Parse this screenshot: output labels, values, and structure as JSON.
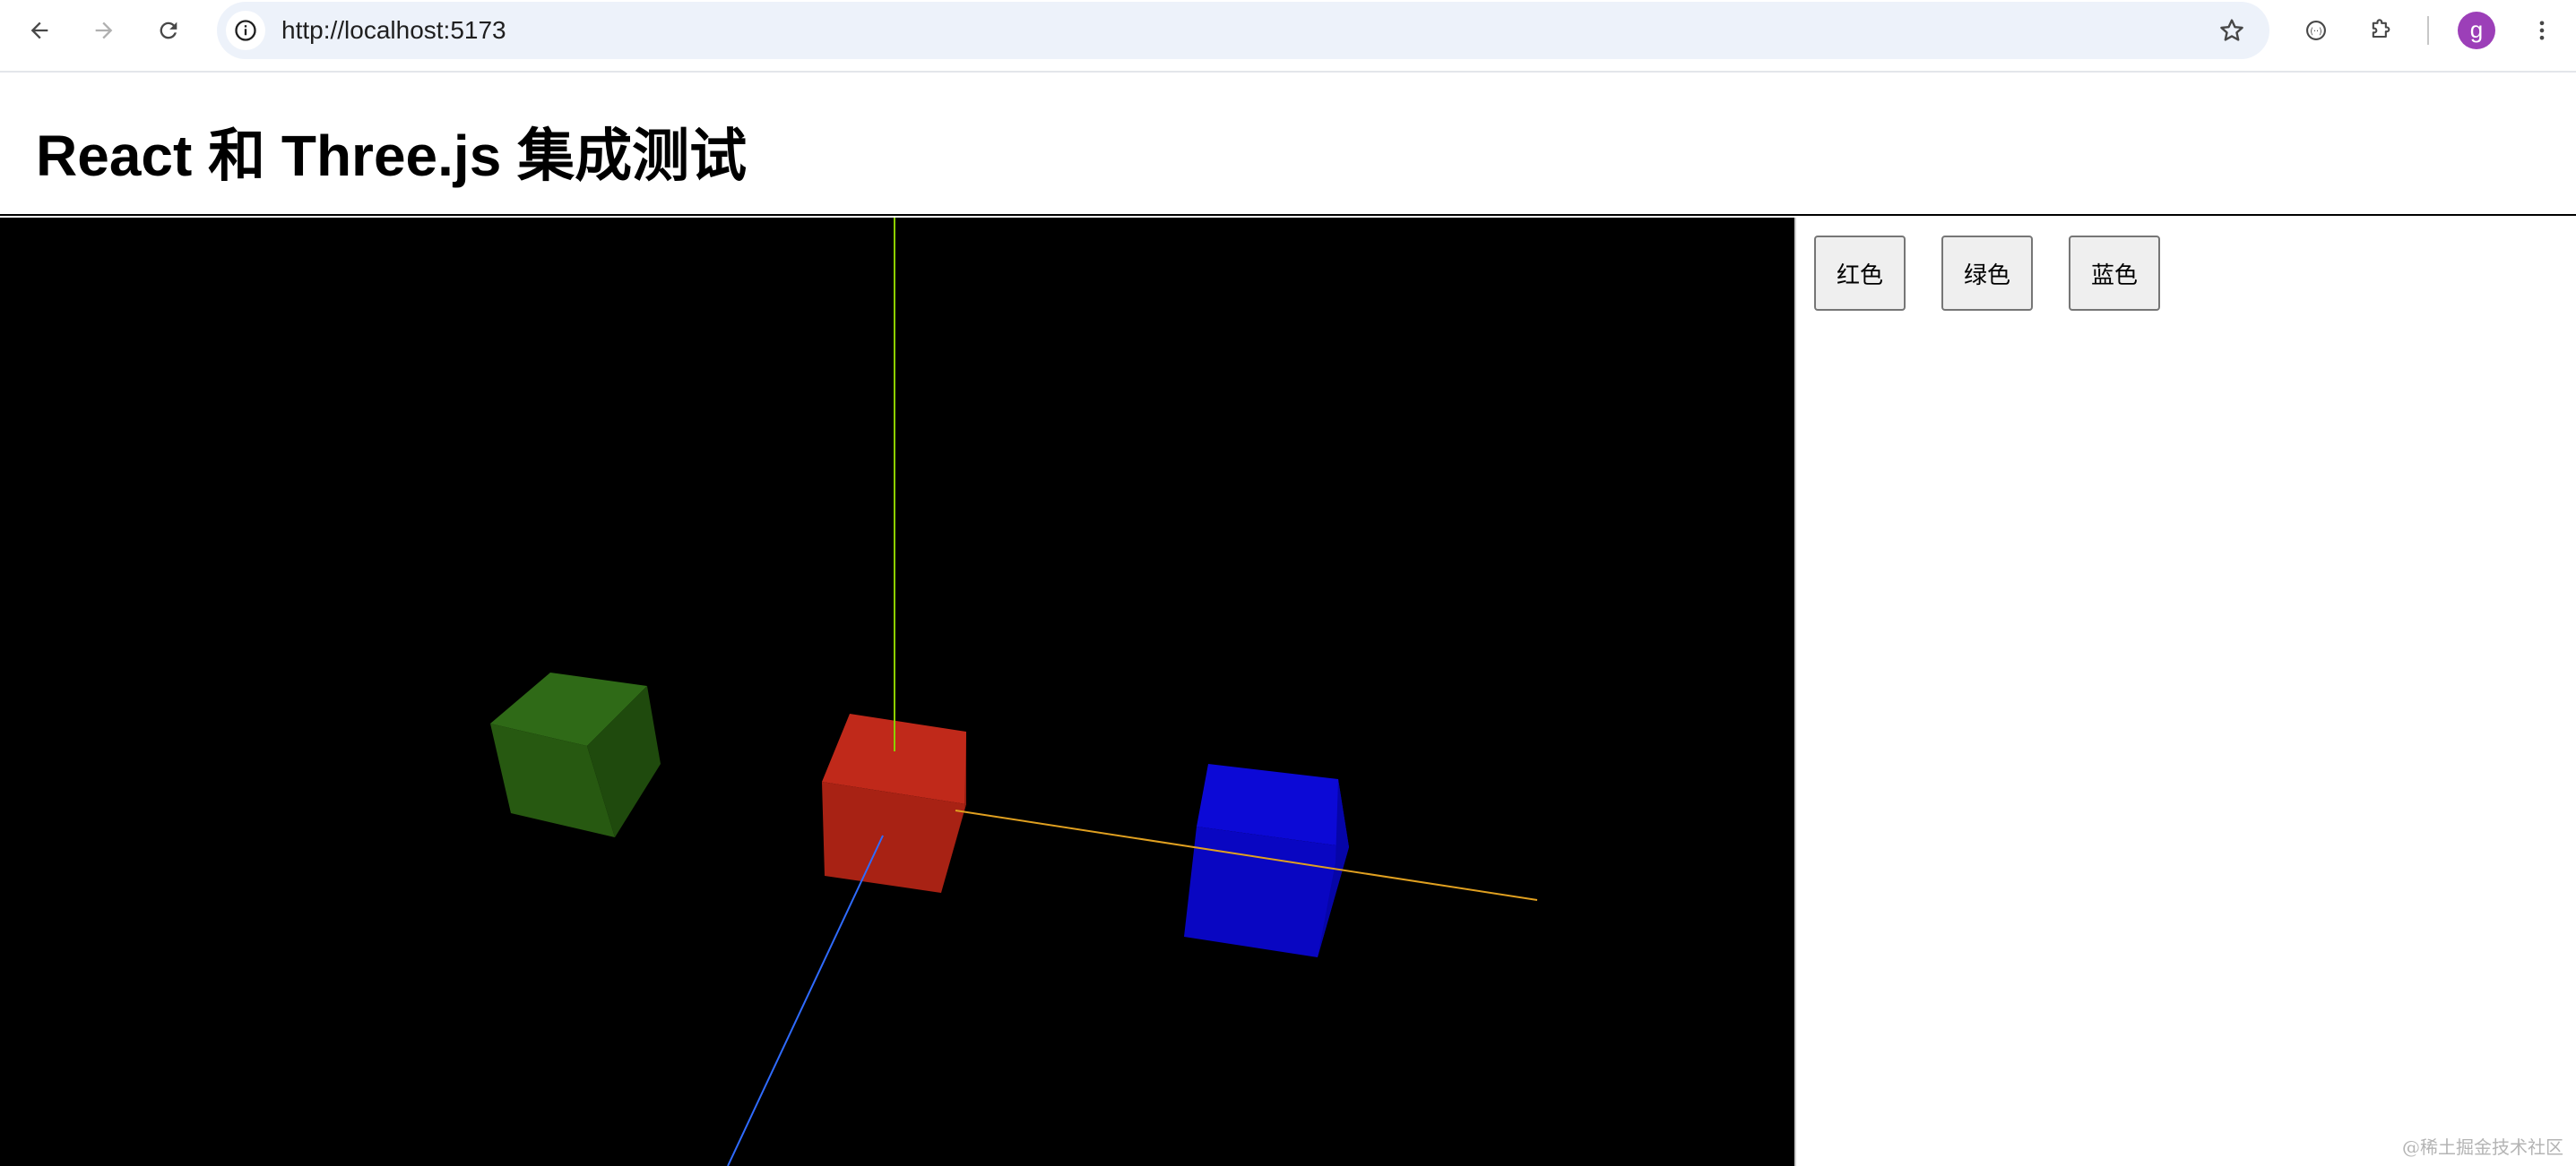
{
  "browser": {
    "url": "http://localhost:5173",
    "avatar_letter": "g",
    "icons": {
      "back": "arrow-left-icon",
      "forward": "arrow-right-icon",
      "reload": "reload-icon",
      "site_info": "info-icon",
      "bookmark": "star-icon",
      "lens": "lens-icon",
      "extensions": "puzzle-icon",
      "menu": "kebab-menu-icon"
    }
  },
  "page": {
    "title": "React 和 Three.js 集成测试"
  },
  "controls": {
    "buttons": [
      {
        "label": "红色"
      },
      {
        "label": "绿色"
      },
      {
        "label": "蓝色"
      }
    ]
  },
  "scene": {
    "background": "#000000",
    "cubes": [
      {
        "name": "green-cube",
        "color": "#2a5e13"
      },
      {
        "name": "red-cube",
        "color": "#b52415"
      },
      {
        "name": "blue-cube",
        "color": "#0b06c9"
      }
    ],
    "axes": {
      "x_color": "#ff8c00",
      "y_color": "#8ccf00",
      "z_color": "#2f6bff"
    }
  },
  "watermark": "@稀土掘金技术社区"
}
